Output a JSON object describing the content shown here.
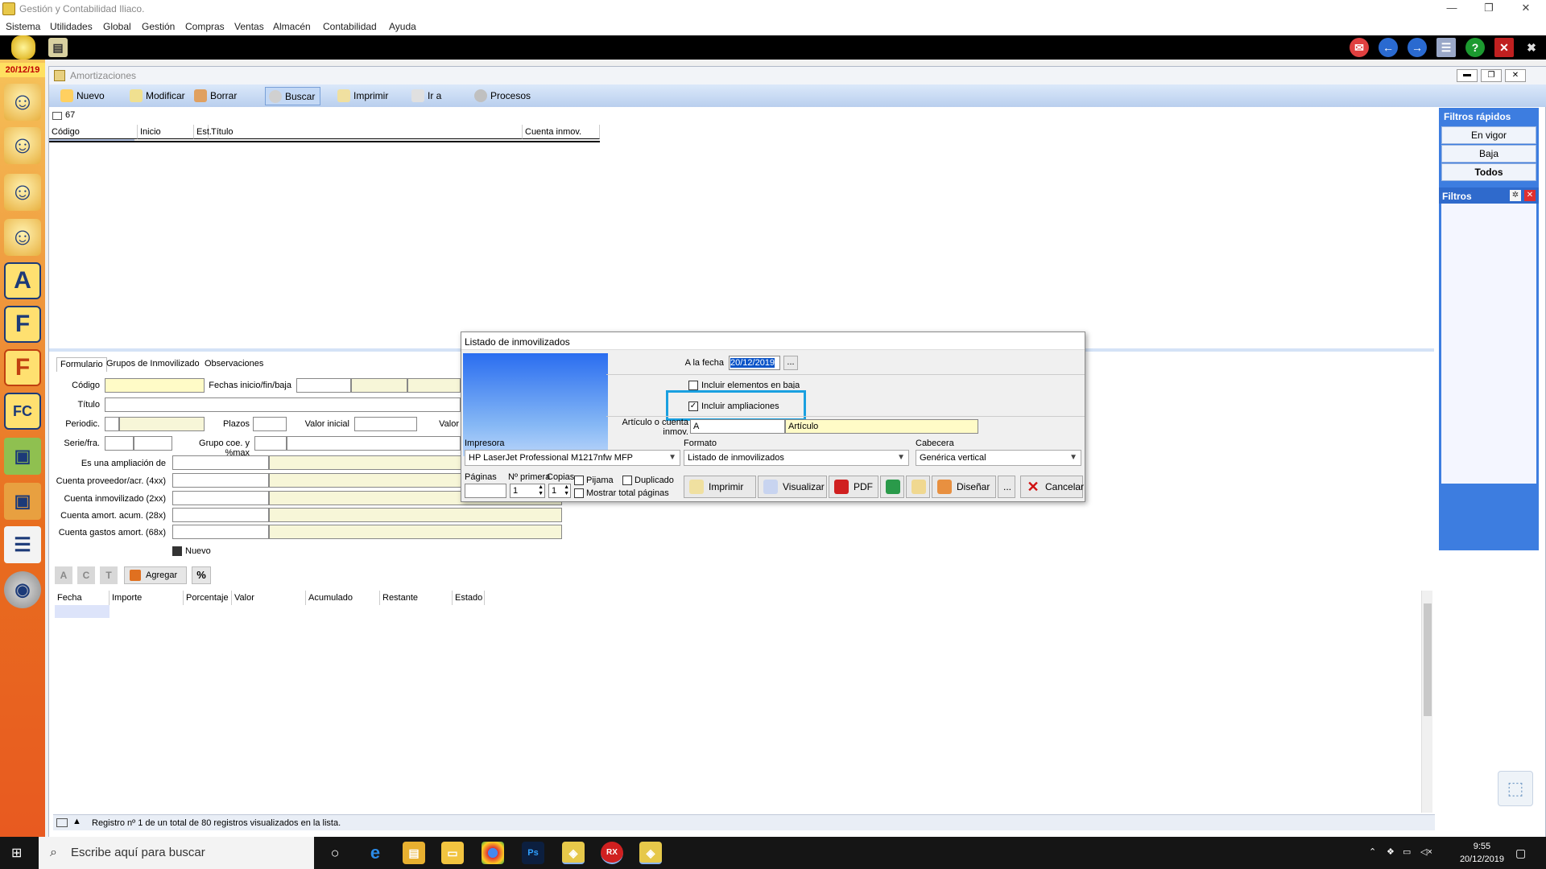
{
  "window": {
    "title": "Gestión y Contabilidad Iliaco."
  },
  "menu": [
    "Sistema",
    "Utilidades",
    "Global",
    "Gestión",
    "Compras",
    "Ventas",
    "Almacén",
    "Contabilidad",
    "Ayuda"
  ],
  "sidebar": {
    "date": "20/12/19",
    "letters": [
      "A",
      "F",
      "F",
      "FC"
    ]
  },
  "module": {
    "title": "Amortizaciones",
    "toolbar": [
      "Nuevo",
      "Modificar",
      "Borrar",
      "Buscar",
      "Imprimir",
      "Ir a",
      "Procesos"
    ],
    "count": "67",
    "columns": [
      "Código",
      "Inicio",
      "Est.",
      "Título",
      "Cuenta inmov."
    ]
  },
  "quickfilters": {
    "title": "Filtros rápidos",
    "items": [
      "En vigor",
      "Baja",
      "Todos"
    ],
    "filters_title": "Filtros"
  },
  "tabs": [
    "Formulario",
    "Grupos de Inmovilizado",
    "Observaciones"
  ],
  "form": {
    "codigo": "Código",
    "fechas": "Fechas inicio/fin/baja",
    "titulo": "Título",
    "periodic": "Periodic.",
    "plazos": "Plazos",
    "valor_inicial": "Valor inicial",
    "valor": "Valor",
    "serie": "Serie/fra.",
    "grupo": "Grupo coe. y %max",
    "ampliacion": "Es una ampliación de",
    "proveedor": "Cuenta proveedor/acr. (4xx)",
    "inmovilizado": "Cuenta inmovilizado (2xx)",
    "amort_acum": "Cuenta amort. acum. (28x)",
    "gastos": "Cuenta gastos amort. (68x)",
    "nuevo": "Nuevo"
  },
  "lower_toolbar": {
    "a": "A",
    "c": "C",
    "t": "T",
    "agregar": "Agregar",
    "pct": "%"
  },
  "lower_grid": [
    "Fecha",
    "Importe",
    "Porcentaje",
    "Valor",
    "Acumulado",
    "Restante",
    "Estado"
  ],
  "status": "Registro nº 1 de un total de 80 registros visualizados en la lista.",
  "dialog": {
    "title": "Listado de inmovilizados",
    "a_la_fecha_label": "A la fecha",
    "a_la_fecha": "20/12/2019",
    "dots": "...",
    "incluir_baja": "Incluir elementos en baja",
    "incluir_ampliaciones": "Incluir ampliaciones",
    "articulo_label": "Artículo o cuenta inmov.",
    "articulo_code": "A",
    "articulo_name": "Artículo",
    "impresora_label": "Impresora",
    "impresora": "HP LaserJet Professional M1217nfw MFP",
    "formato_label": "Formato",
    "formato": "Listado de inmovilizados",
    "cabecera_label": "Cabecera",
    "cabecera": "Genérica vertical",
    "paginas": "Páginas",
    "primera": "Nº primera",
    "copias": "Copias",
    "primera_val": "1",
    "copias_val": "1",
    "pijama": "Pijama",
    "duplicado": "Duplicado",
    "mostrar": "Mostrar total páginas",
    "btn_imprimir": "Imprimir",
    "btn_visualizar": "Visualizar",
    "btn_pdf": "PDF",
    "btn_disenar": "Diseñar",
    "btn_more": "...",
    "btn_cancelar": "Cancelar"
  },
  "taskbar": {
    "search": "Escribe aquí para buscar",
    "time": "9:55",
    "date": "20/12/2019"
  }
}
